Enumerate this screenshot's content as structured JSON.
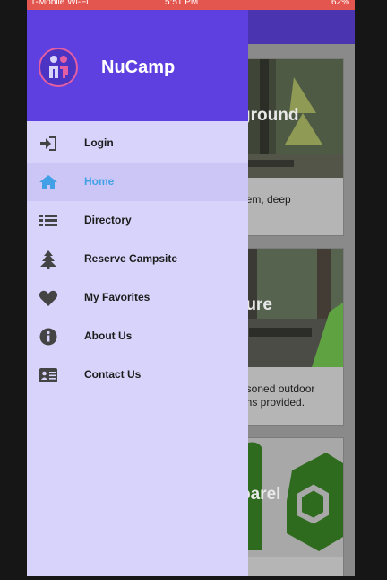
{
  "status_bar": {
    "carrier": "T-Mobile Wi-Fi",
    "time": "5:51 PM",
    "battery": "62%"
  },
  "drawer": {
    "brand": "NuCamp",
    "items": [
      {
        "label": "Login",
        "icon": "sign-in-icon"
      },
      {
        "label": "Home",
        "icon": "home-icon",
        "active": true
      },
      {
        "label": "Directory",
        "icon": "list-icon"
      },
      {
        "label": "Reserve Campsite",
        "icon": "tree-icon"
      },
      {
        "label": "My Favorites",
        "icon": "heart-icon"
      },
      {
        "label": "About Us",
        "icon": "info-circle-icon"
      },
      {
        "label": "Contact Us",
        "icon": "address-card-icon"
      }
    ]
  },
  "cards": [
    {
      "overlay": "ground",
      "desc": "gem, deep"
    },
    {
      "overlay": "ture",
      "desc_lines": [
        "asoned outdoor",
        "ons provided."
      ]
    },
    {
      "overlay": "oarel",
      "desc": ""
    }
  ],
  "colors": {
    "drawer_header": "#5e3fe0",
    "drawer_bg": "#d8d3fb",
    "active_item": "#42a1e6",
    "status_bar": "#e2564f"
  }
}
